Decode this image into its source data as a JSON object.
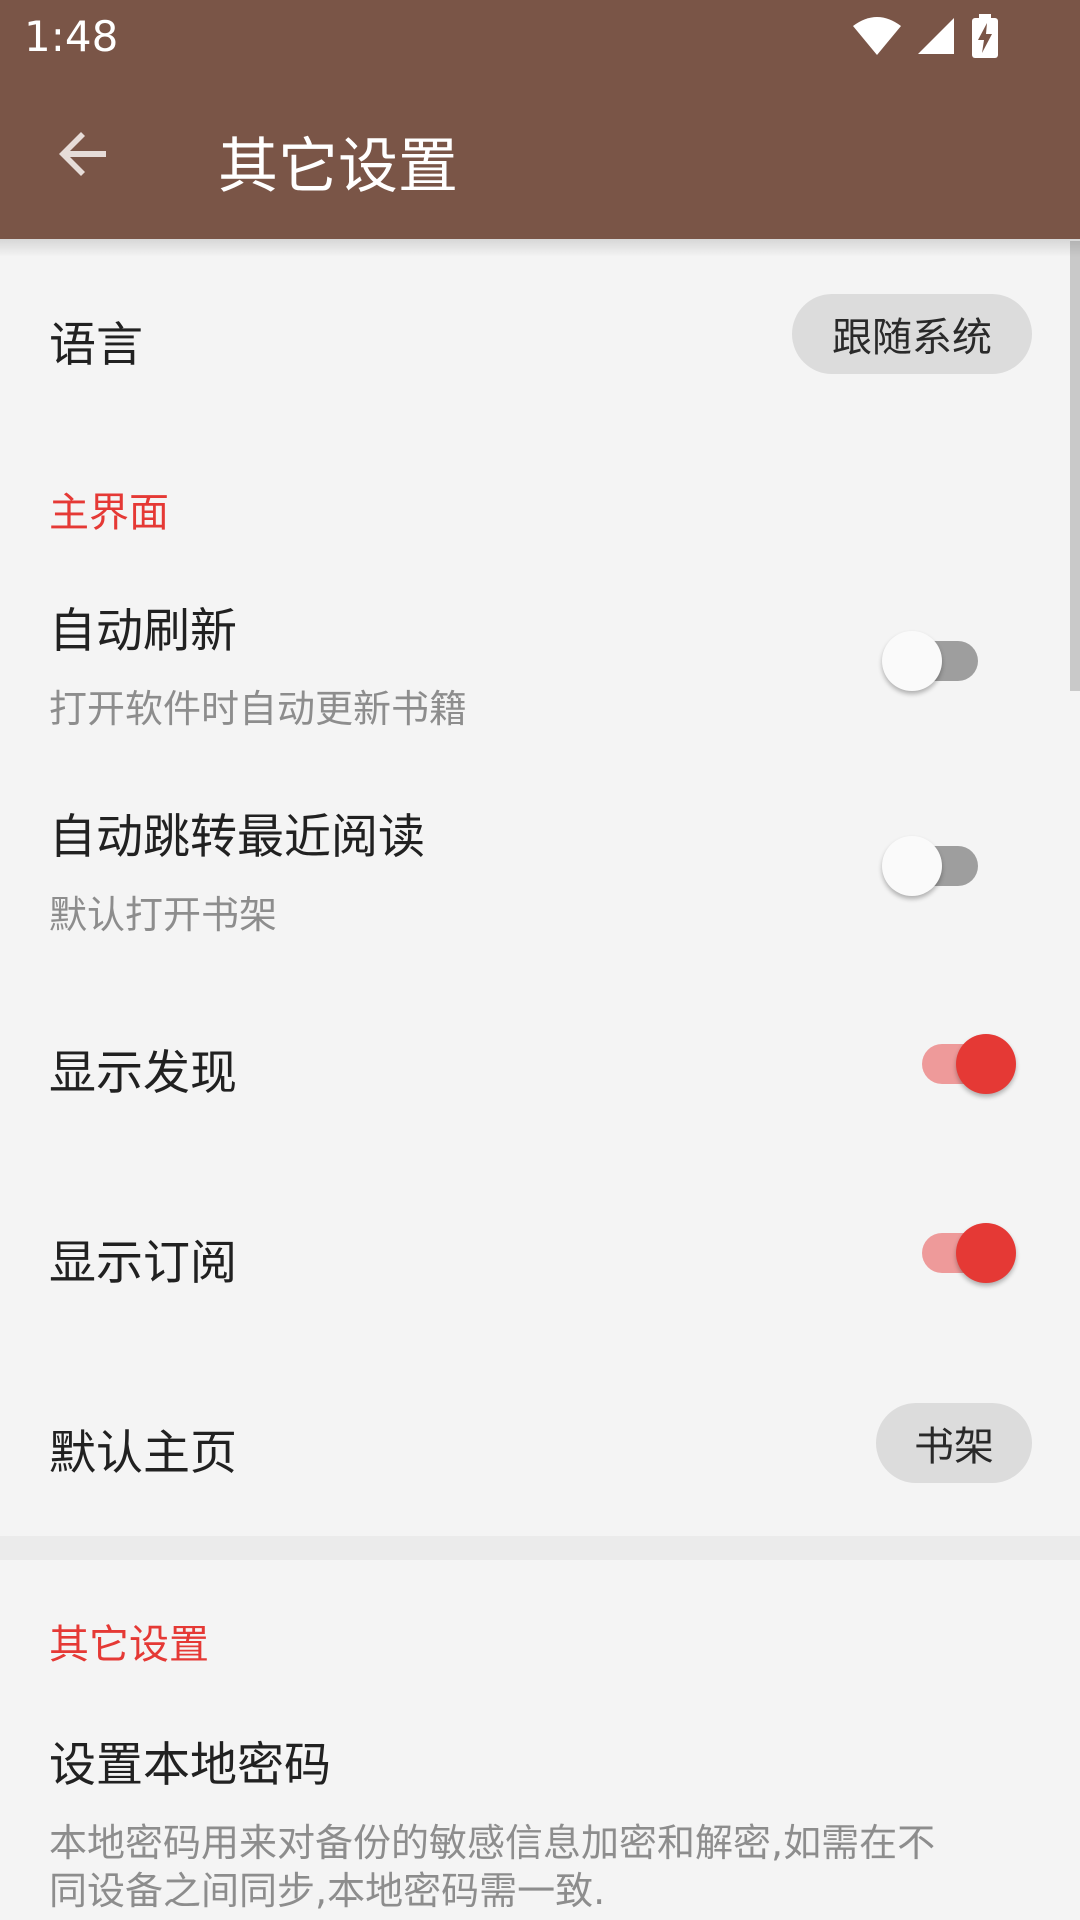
{
  "status_bar": {
    "time": "1:48",
    "icons": [
      "wifi-icon",
      "signal-icon",
      "battery-charging-icon"
    ]
  },
  "app_bar": {
    "title": "其它设置",
    "back_icon": "arrow-back-icon",
    "color": "#7a5547"
  },
  "accent_color": "#e53935",
  "settings": {
    "language": {
      "label": "语言",
      "value": "跟随系统"
    },
    "main_section": {
      "header": "主界面",
      "auto_refresh": {
        "title": "自动刷新",
        "subtitle": "打开软件时自动更新书籍",
        "enabled": false
      },
      "auto_jump": {
        "title": "自动跳转最近阅读",
        "subtitle": "默认打开书架",
        "enabled": false
      },
      "show_discover": {
        "title": "显示发现",
        "enabled": true
      },
      "show_rss": {
        "title": "显示订阅",
        "enabled": true
      },
      "default_home": {
        "title": "默认主页",
        "value": "书架"
      }
    },
    "other_section": {
      "header": "其它设置",
      "local_password": {
        "title": "设置本地密码",
        "subtitle_line1": "本地密码用来对备份的敏感信息加密和解密,如需在不",
        "subtitle_line2": "同设备之间同步,本地密码需一致."
      }
    }
  }
}
